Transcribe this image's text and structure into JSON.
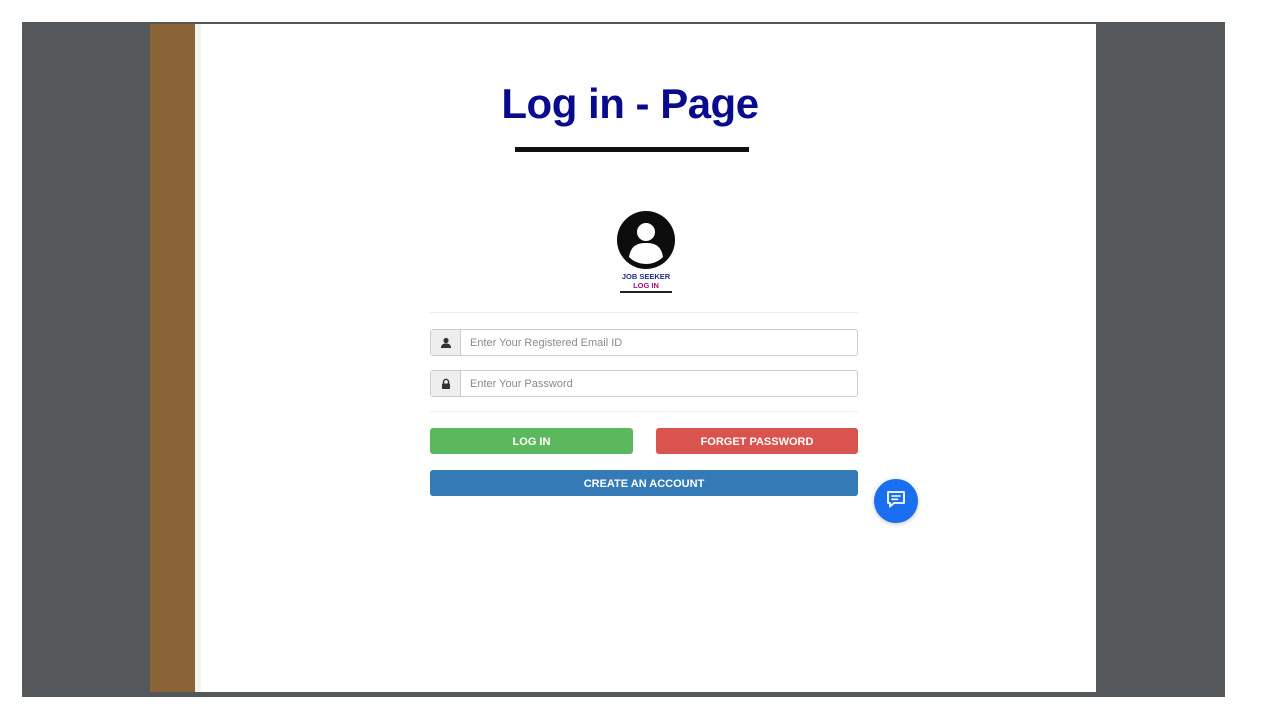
{
  "page": {
    "title": "Log in - Page"
  },
  "avatar": {
    "icon": "user-circle-icon",
    "caption_line1": "JOB SEEKER",
    "caption_line2": "LOG IN"
  },
  "form": {
    "email": {
      "icon": "user-icon",
      "placeholder": "Enter Your Registered Email ID",
      "value": ""
    },
    "password": {
      "icon": "lock-icon",
      "placeholder": "Enter Your Password",
      "value": ""
    }
  },
  "buttons": {
    "login_label": "LOG IN",
    "forget_label": "FORGET PASSWORD",
    "create_label": "CREATE AN ACCOUNT"
  },
  "chat": {
    "icon": "chat-icon"
  },
  "colors": {
    "title": "#0a0a8c",
    "login": "#5cb85c",
    "forget": "#d9534f",
    "create": "#337ab7",
    "chat": "#1a6ff0",
    "sidebar": "#8a6437",
    "frame": "#54585b"
  }
}
